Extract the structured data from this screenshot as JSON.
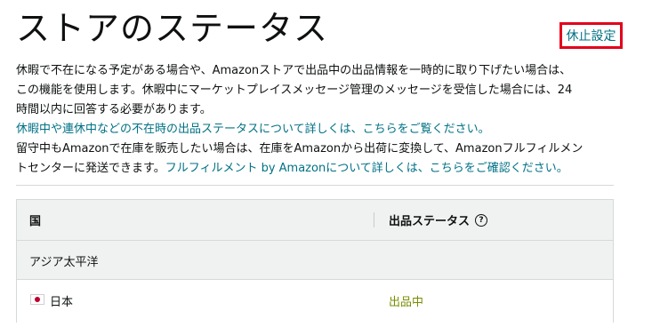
{
  "page": {
    "title": "ストアのステータス",
    "suspend_button": "休止設定"
  },
  "description": {
    "line1": "休暇で不在になる予定がある場合や、Amazonストアで出品中の出品情報を一時的に取り下げたい場合は、",
    "line2": "この機能を使用します。休暇中にマーケットプレイスメッセージ管理のメッセージを受信した場合には、24",
    "line3": "時間以内に回答する必要があります。",
    "link1": "休暇中や連休中などの不在時の出品ステータスについて詳しくは、こちらをご覧ください。",
    "line4": "留守中もAmazonで在庫を販売したい場合は、在庫をAmazonから出荷に変換して、Amazonフルフィルメン",
    "line5_text": "トセンターに発送できます。",
    "link2": "フルフィルメント by Amazonについて詳しくは、こちらをご確認ください。"
  },
  "table": {
    "header_country": "国",
    "header_status": "出品ステータス",
    "help_icon": "question-circle-icon",
    "regions": [
      {
        "name": "アジア太平洋",
        "countries": [
          {
            "name": "日本",
            "flag": "japan-flag-icon",
            "status": "出品中",
            "status_color": "#7a8c00"
          }
        ]
      }
    ]
  },
  "colors": {
    "link": "#007185",
    "highlight_border": "#e3001b",
    "status_active": "#7a8c00",
    "table_header_bg": "#f0f2f2"
  }
}
